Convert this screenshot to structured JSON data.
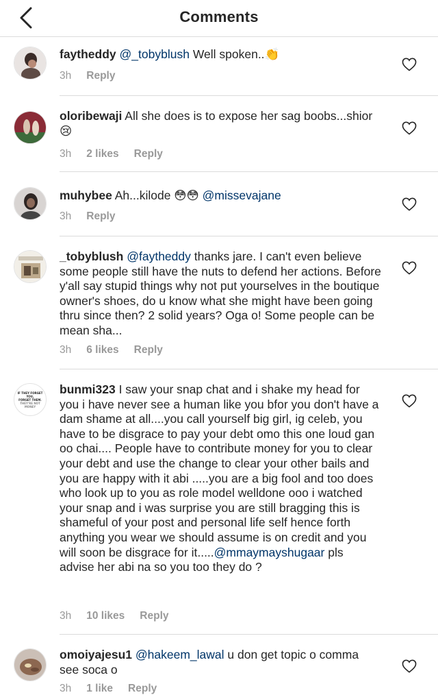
{
  "header": {
    "title": "Comments",
    "back_icon": "chevron-left-icon"
  },
  "comments": [
    {
      "username": "faytheddy",
      "mention": "@_tobyblush",
      "text_after": " Well spoken..👏",
      "time": "3h",
      "likes": "",
      "reply": "Reply"
    },
    {
      "username": "oloribewaji",
      "mention": "",
      "text_after": " All she does is to expose her sag boobs...shior😢",
      "time": "3h",
      "likes": "2 likes",
      "reply": "Reply"
    },
    {
      "username": "muhybee",
      "mention_pre": " Ah...kilode 😳😳 ",
      "mention": "@missevajane",
      "time": "3h",
      "likes": "",
      "reply": "Reply"
    },
    {
      "username": "_tobyblush",
      "mention": "@faytheddy",
      "text_after": " thanks jare. I can't even believe some people still have the nuts to defend her actions. Before y'all say stupid things why not put yourselves in the boutique owner's shoes, do u know what she might have been going thru since then? 2 solid years? Oga o! Some people can be mean sha...",
      "time": "3h",
      "likes": "6 likes",
      "reply": "Reply"
    },
    {
      "username": "bunmi323",
      "text_before": " I saw your snap chat and i shake my head for you i have never see a human like you bfor you don't have a dam shame at all....you call yourself big girl, ig celeb, you have to be disgrace to pay your debt omo this one loud gan oo chai.... People have to contribute money for you to clear your debt and use the change to clear your other bails and you are happy with it abi .....you are a big fool and too does who look up to you as role model welldone ooo i watched your snap and i was surprise you are still bragging this is shameful of your post and personal life self hence forth anything you wear we should assume is on credit and you will soon be disgrace for it.....",
      "mention": "@mmaymayshugaar",
      "text_after": " pls advise her abi na so you too they do ?",
      "avatar_text": [
        "IF THEY FORGET YOU,",
        "FORGET THEM.",
        "THEY'RE NOT MONEY"
      ],
      "time": "3h",
      "likes": "10 likes",
      "reply": "Reply"
    },
    {
      "username": "omoiyajesu1",
      "mention": "@hakeem_lawal",
      "text_after": " u don get topic o comma see soca o",
      "time": "3h",
      "likes": "1 like",
      "reply": "Reply"
    }
  ],
  "colors": {
    "mention": "#003569",
    "meta": "#999999",
    "divider": "#dbdbdb"
  }
}
